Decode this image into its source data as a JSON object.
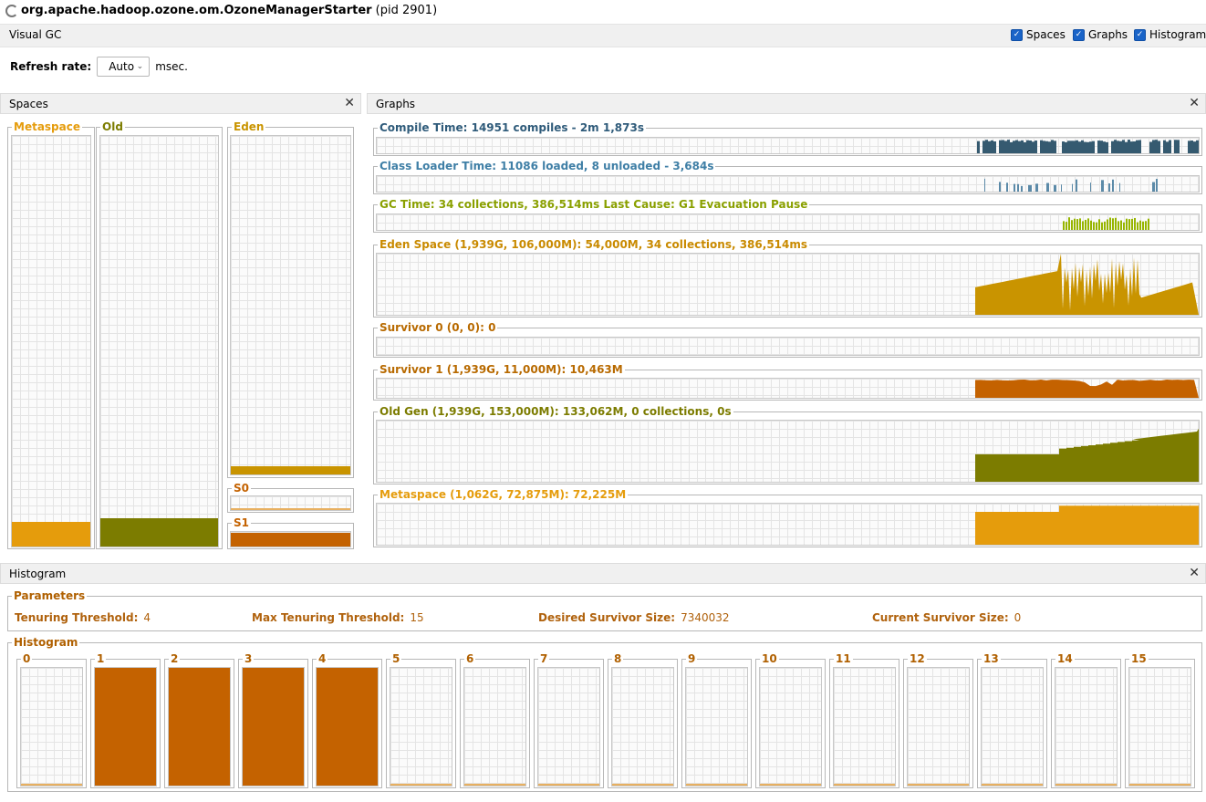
{
  "window": {
    "title_bold": "org.apache.hadoop.ozone.om.OzoneManagerStarter",
    "title_rest": " (pid 2901)"
  },
  "toolbar": {
    "label": "Visual GC",
    "checkboxes": [
      {
        "label": "Spaces",
        "checked": true
      },
      {
        "label": "Graphs",
        "checked": true
      },
      {
        "label": "Histogram",
        "checked": true
      }
    ]
  },
  "refresh": {
    "label": "Refresh rate:",
    "value": "Auto",
    "unit": "msec."
  },
  "colors": {
    "metaspace": "#e59c0c",
    "old": "#7c7c00",
    "eden": "#c99400",
    "survivor": "#c46200",
    "compile": "#355a70",
    "classloader": "#5b8aa8",
    "gc": "#97b500",
    "label_blue": "#2f5b7a",
    "label_gc": "#8aa000",
    "label_orange": "#b86a00"
  },
  "spaces": {
    "title": "Spaces",
    "metaspace": {
      "label": "Metaspace",
      "fill": 0.06
    },
    "old": {
      "label": "Old",
      "fill": 0.07
    },
    "eden": {
      "label": "Eden",
      "fill": 0.025
    },
    "s0": {
      "label": "S0",
      "fill": 0.0
    },
    "s1": {
      "label": "S1",
      "fill": 0.95
    }
  },
  "graphs": {
    "title": "Graphs",
    "items": [
      {
        "label": "Compile Time: 14951 compiles - 2m 1,873s"
      },
      {
        "label": "Class Loader Time: 11086 loaded, 8 unloaded - 3,684s"
      },
      {
        "label": "GC Time: 34 collections, 386,514ms Last Cause: G1 Evacuation Pause"
      },
      {
        "label": "Eden Space (1,939G, 106,000M): 54,000M, 34 collections, 386,514ms"
      },
      {
        "label": "Survivor 0 (0, 0): 0"
      },
      {
        "label": "Survivor 1 (1,939G, 11,000M): 10,463M"
      },
      {
        "label": "Old Gen (1,939G, 153,000M): 133,062M, 0 collections, 0s"
      },
      {
        "label": "Metaspace (1,062G, 72,875M): 72,225M"
      }
    ]
  },
  "histogram": {
    "title": "Histogram",
    "parameters_label": "Parameters",
    "params": [
      {
        "key": "Tenuring Threshold:",
        "value": "4"
      },
      {
        "key": "Max Tenuring Threshold:",
        "value": "15"
      },
      {
        "key": "Desired Survivor Size:",
        "value": "7340032"
      },
      {
        "key": "Current Survivor Size:",
        "value": "0"
      }
    ],
    "histogram_label": "Histogram",
    "bins": [
      {
        "label": "0",
        "fill": 0
      },
      {
        "label": "1",
        "fill": 1
      },
      {
        "label": "2",
        "fill": 1
      },
      {
        "label": "3",
        "fill": 1
      },
      {
        "label": "4",
        "fill": 1
      },
      {
        "label": "5",
        "fill": 0
      },
      {
        "label": "6",
        "fill": 0
      },
      {
        "label": "7",
        "fill": 0
      },
      {
        "label": "8",
        "fill": 0
      },
      {
        "label": "9",
        "fill": 0
      },
      {
        "label": "10",
        "fill": 0
      },
      {
        "label": "11",
        "fill": 0
      },
      {
        "label": "12",
        "fill": 0
      },
      {
        "label": "13",
        "fill": 0
      },
      {
        "label": "14",
        "fill": 0
      },
      {
        "label": "15",
        "fill": 0
      }
    ]
  }
}
